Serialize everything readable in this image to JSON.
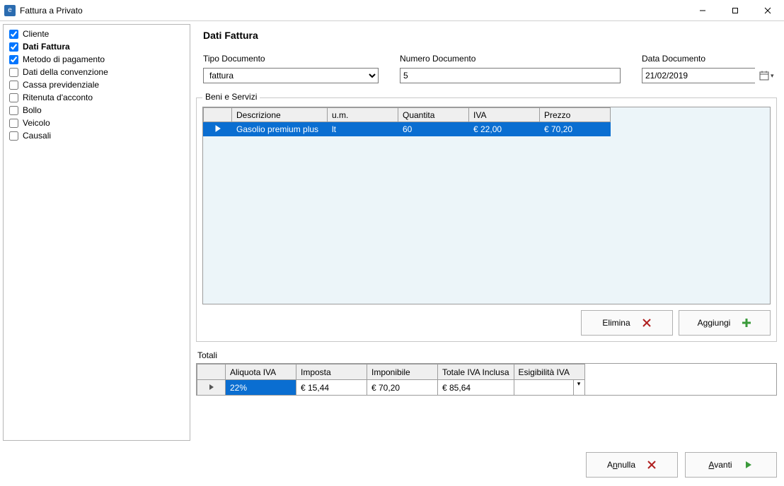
{
  "window": {
    "title": "Fattura a Privato"
  },
  "sidebar": {
    "items": [
      {
        "label": "Cliente",
        "checked": true,
        "active": false
      },
      {
        "label": "Dati Fattura",
        "checked": true,
        "active": true
      },
      {
        "label": "Metodo di pagamento",
        "checked": true,
        "active": false
      },
      {
        "label": "Dati della convenzione",
        "checked": false,
        "active": false
      },
      {
        "label": "Cassa previdenziale",
        "checked": false,
        "active": false
      },
      {
        "label": "Ritenuta d'acconto",
        "checked": false,
        "active": false
      },
      {
        "label": "Bollo",
        "checked": false,
        "active": false
      },
      {
        "label": "Veicolo",
        "checked": false,
        "active": false
      },
      {
        "label": "Causali",
        "checked": false,
        "active": false
      }
    ]
  },
  "page": {
    "title": "Dati Fattura"
  },
  "fields": {
    "tipo_documento": {
      "label": "Tipo Documento",
      "value": "fattura"
    },
    "numero_documento": {
      "label": "Numero Documento",
      "value": "5"
    },
    "data_documento": {
      "label": "Data Documento",
      "value": "21/02/2019"
    }
  },
  "beni_servizi": {
    "legend": "Beni e Servizi",
    "columns": [
      "Descrizione",
      "u.m.",
      "Quantita",
      "IVA",
      "Prezzo"
    ],
    "rows": [
      {
        "descrizione": "Gasolio premium plus",
        "um": "lt",
        "quantita": "60",
        "iva": "€ 22,00",
        "prezzo": "€ 70,20"
      }
    ]
  },
  "buttons": {
    "elimina": "Elimina",
    "aggiungi": "Aggiungi",
    "annulla": "Annulla",
    "avanti": "Avanti"
  },
  "totali": {
    "legend": "Totali",
    "columns": [
      "Aliquota IVA",
      "Imposta",
      "Imponibile",
      "Totale IVA Inclusa",
      "Esigibilità IVA"
    ],
    "rows": [
      {
        "aliquota": "22%",
        "imposta": "€ 15,44",
        "imponibile": "€ 70,20",
        "totale": "€ 85,64",
        "esigibilita": ""
      }
    ]
  },
  "colors": {
    "selection": "#0a6ed1"
  }
}
